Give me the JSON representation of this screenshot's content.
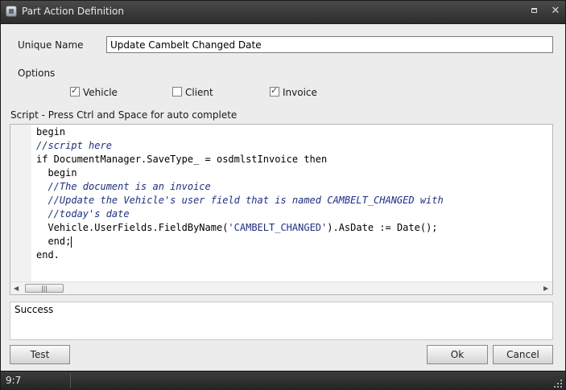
{
  "window": {
    "title": "Part Action Definition"
  },
  "form": {
    "unique_name_label": "Unique Name",
    "unique_name_value": "Update Cambelt Changed Date",
    "options_label": "Options",
    "options": [
      {
        "label": "Vehicle",
        "checked": true
      },
      {
        "label": "Client",
        "checked": false
      },
      {
        "label": "Invoice",
        "checked": true
      }
    ],
    "script_label": "Script - Press Ctrl and Space for auto complete"
  },
  "script": {
    "lines": [
      "begin",
      "//script here",
      "if DocumentManager.SaveType_ = osdmlstInvoice then",
      "  begin",
      "  //The document is an invoice",
      "  //Update the Vehicle's user field that is named CAMBELT_CHANGED with",
      "  //today's date",
      "  Vehicle.UserFields.FieldByName('CAMBELT_CHANGED').AsDate := Date();",
      "  end;",
      "end."
    ]
  },
  "result": {
    "text": "Success"
  },
  "buttons": {
    "test": "Test",
    "ok": "Ok",
    "cancel": "Cancel"
  },
  "statusbar": {
    "cursor_position": "9:7"
  },
  "colors": {
    "titlebar": "#2c2c2c",
    "comment": "#1c2f8c",
    "window_bg": "#ececec"
  }
}
